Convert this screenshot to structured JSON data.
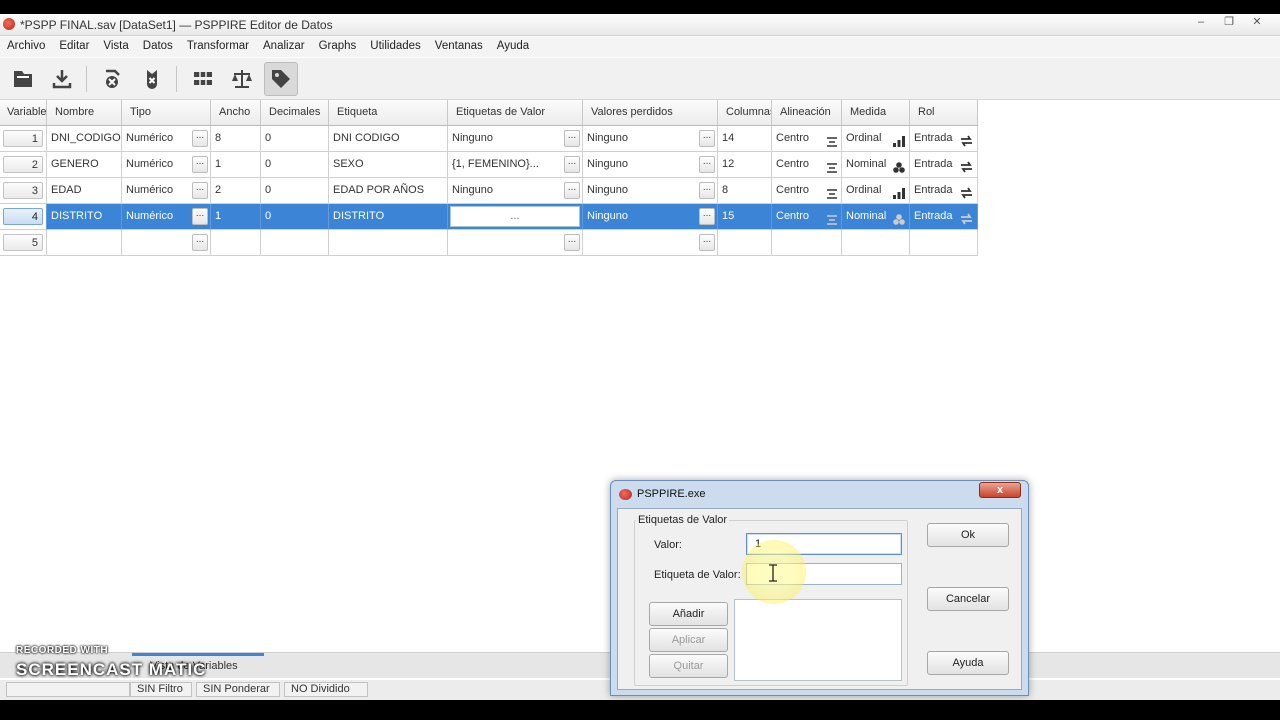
{
  "window": {
    "title": "*PSPP FINAL.sav [DataSet1] — PSPPIRE Editor de Datos",
    "controls": [
      "–",
      "❐",
      "✕"
    ]
  },
  "menu": [
    "Archivo",
    "Editar",
    "Vista",
    "Datos",
    "Transformar",
    "Analizar",
    "Graphs",
    "Utilidades",
    "Ventanas",
    "Ayuda"
  ],
  "toolbar": {
    "buttons": [
      "open-icon",
      "save-icon",
      "goto-case-icon",
      "goto-variable-icon",
      "split-icon",
      "weight-icon",
      "value-labels-icon"
    ]
  },
  "grid": {
    "columns": [
      "Variable",
      "Nombre",
      "Tipo",
      "Ancho",
      "Decimales",
      "Etiqueta",
      "Etiquetas de Valor",
      "Valores perdidos",
      "Columnas",
      "Alineación",
      "Medida",
      "Rol"
    ],
    "ellipsis": "...",
    "rows": [
      {
        "num": "1",
        "nombre": "DNI_CODIGO",
        "tipo": "Numérico",
        "ancho": "8",
        "decimales": "0",
        "etiqueta": "DNI CODIGO",
        "etiquetas_valor": "Ninguno",
        "valores_perdidos": "Ninguno",
        "columnas": "14",
        "alineacion": "Centro",
        "medida": "Ordinal",
        "rol": "Entrada"
      },
      {
        "num": "2",
        "nombre": "GENERO",
        "tipo": "Numérico",
        "ancho": "1",
        "decimales": "0",
        "etiqueta": "SEXO",
        "etiquetas_valor": "{1, FEMENINO}...",
        "valores_perdidos": "Ninguno",
        "columnas": "12",
        "alineacion": "Centro",
        "medida": "Nominal",
        "rol": "Entrada"
      },
      {
        "num": "3",
        "nombre": "EDAD",
        "tipo": "Numérico",
        "ancho": "2",
        "decimales": "0",
        "etiqueta": "EDAD POR AÑOS",
        "etiquetas_valor": "Ninguno",
        "valores_perdidos": "Ninguno",
        "columnas": "8",
        "alineacion": "Centro",
        "medida": "Ordinal",
        "rol": "Entrada"
      },
      {
        "num": "4",
        "nombre": "DISTRITO",
        "tipo": "Numérico",
        "ancho": "1",
        "decimales": "0",
        "etiqueta": "DISTRITO",
        "etiquetas_valor": "...",
        "valores_perdidos": "Ninguno",
        "columnas": "15",
        "alineacion": "Centro",
        "medida": "Nominal",
        "rol": "Entrada"
      },
      {
        "num": "5",
        "nombre": "",
        "tipo": "",
        "ancho": "",
        "decimales": "",
        "etiqueta": "",
        "etiquetas_valor": "",
        "valores_perdidos": "",
        "columnas": "",
        "alineacion": "",
        "medida": "",
        "rol": ""
      }
    ],
    "selected_row": "4"
  },
  "tabs": {
    "active": "Vista de Variables"
  },
  "status": {
    "filter": "SIN Filtro",
    "weight": "SIN Ponderar",
    "split": "NO Dividido"
  },
  "watermark": {
    "line1": "RECORDED WITH",
    "line2": "SCREENCAST MATIC"
  },
  "dialog": {
    "title": "PSPPIRE.exe",
    "close": "x",
    "frame_label": "Etiquetas de Valor",
    "valor_label": "Valor:",
    "valor_value": "1",
    "etiqueta_label": "Etiqueta de Valor:",
    "etiqueta_value": "",
    "btn_add": "Añadir",
    "btn_apply": "Aplicar",
    "btn_remove": "Quitar",
    "btn_ok": "Ok",
    "btn_cancel": "Cancelar",
    "btn_help": "Ayuda"
  },
  "colors": {
    "selection": "#3b84d6",
    "dialog_frame": "#cbdcee",
    "close_button": "#c8452b"
  }
}
